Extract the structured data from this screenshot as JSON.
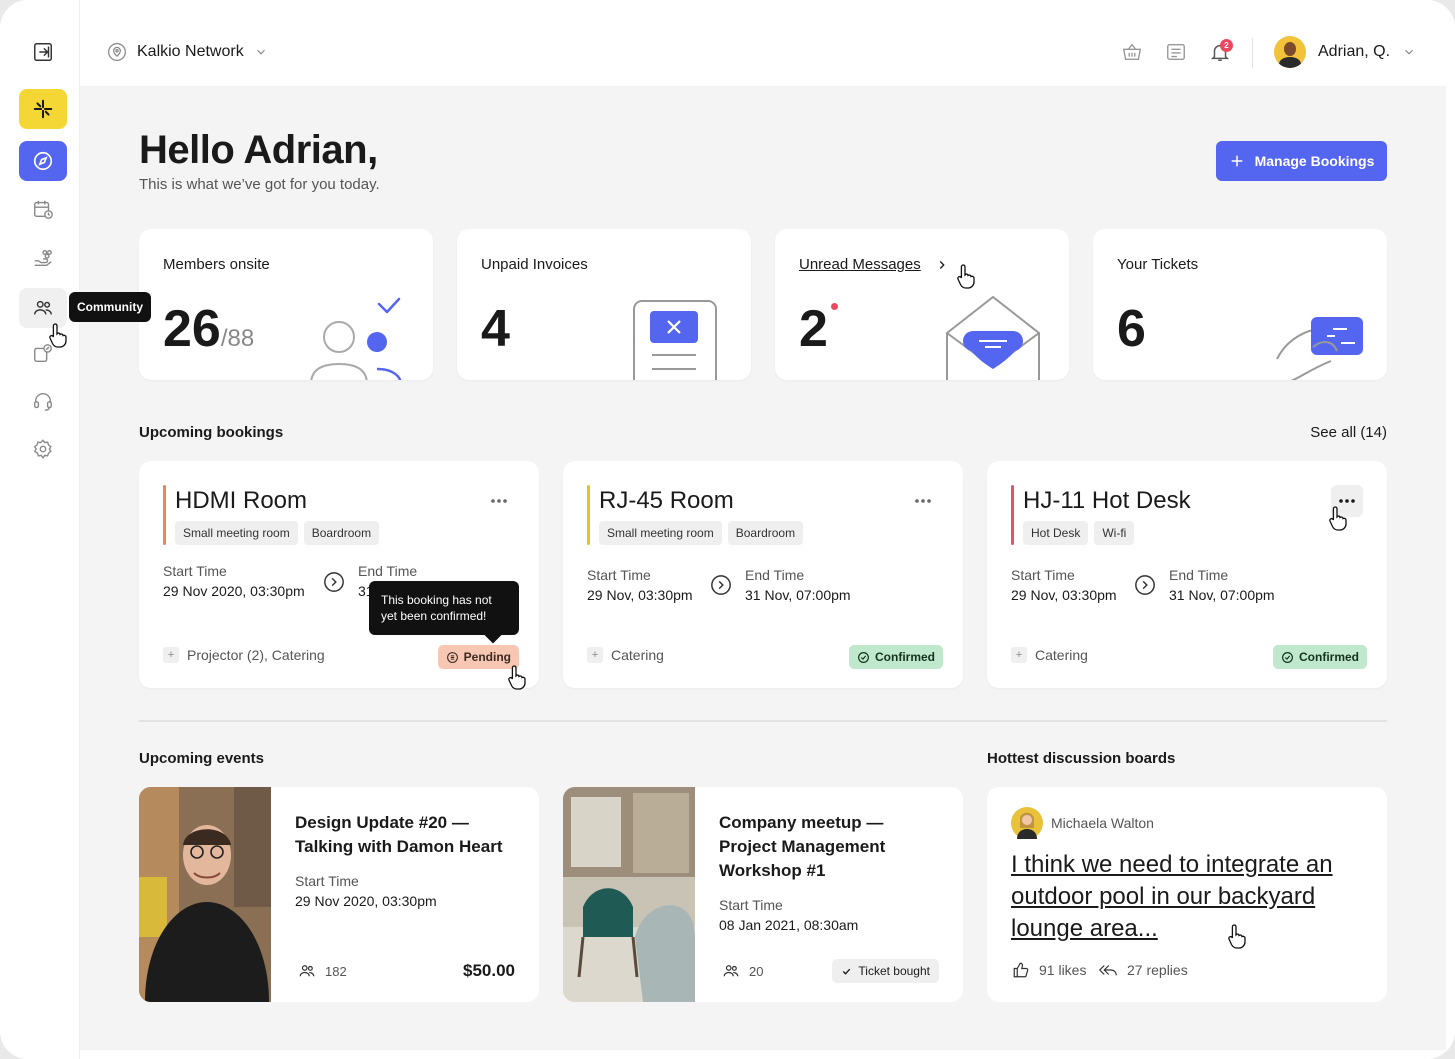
{
  "topbar": {
    "network": "Kalkio Network",
    "notification_count": "2",
    "user_name": "Adrian, Q."
  },
  "sidebar": {
    "tooltip": "Community",
    "items": [
      "expand-icon",
      "logo-icon",
      "compass-icon",
      "calendar-clock-icon",
      "hand-coins-icon",
      "people-icon",
      "ticket-icon",
      "headset-icon",
      "gear-icon"
    ]
  },
  "header": {
    "greeting": "Hello Adrian,",
    "subtitle": "This is what we’ve got for you today.",
    "manage_label": "Manage Bookings"
  },
  "stats": {
    "members_label": "Members onsite",
    "members_value": "26",
    "members_total": "/88",
    "invoices_label": "Unpaid Invoices",
    "invoices_value": "4",
    "messages_label": "Unread Messages",
    "messages_value": "2",
    "tickets_label": "Your Tickets",
    "tickets_value": "6"
  },
  "bookings": {
    "title": "Upcoming bookings",
    "see_all": "See all (14)",
    "start_label": "Start Time",
    "end_label": "End Time",
    "tooltip": "This booking has not yet been confirmed!",
    "items": [
      {
        "name": "HDMI Room",
        "accent": "#e8875a",
        "tags": [
          "Small meeting room",
          "Boardroom"
        ],
        "start": "29 Nov 2020, 03:30pm",
        "end": "31",
        "amenities": "Projector (2), Catering",
        "status": "Pending"
      },
      {
        "name": "RJ-45 Room",
        "accent": "#e6c12f",
        "tags": [
          "Small meeting room",
          "Boardroom"
        ],
        "start": "29 Nov, 03:30pm",
        "end": "31 Nov, 07:00pm",
        "amenities": "Catering",
        "status": "Confirmed"
      },
      {
        "name": "HJ-11 Hot Desk",
        "accent": "#e0556b",
        "tags": [
          "Hot Desk",
          "Wi-fi"
        ],
        "start": "29 Nov, 03:30pm",
        "end": "31 Nov, 07:00pm",
        "amenities": "Catering",
        "status": "Confirmed"
      }
    ]
  },
  "events": {
    "title": "Upcoming events",
    "start_label": "Start Time",
    "items": [
      {
        "title": "Design Update #20 — Talking with Damon Heart",
        "start": "29 Nov 2020, 03:30pm",
        "attendees": "182",
        "price": "$50.00"
      },
      {
        "title": "Company meetup — Project Management Workshop #1",
        "start": "08 Jan 2021, 08:30am",
        "attendees": "20",
        "badge": "Ticket bought"
      }
    ]
  },
  "discussion": {
    "title": "Hottest discussion boards",
    "author": "Michaela Walton",
    "post": "I think we need to integrate an outdoor pool in our backyard lounge area...",
    "likes": "91 likes",
    "replies": "27 replies"
  },
  "colors": {
    "accent": "#5466f0",
    "logo": "#f4d734",
    "pending_bg": "#f7c7b3",
    "confirmed_bg": "#bfe8cc",
    "unread_dot": "#e94a5e"
  }
}
